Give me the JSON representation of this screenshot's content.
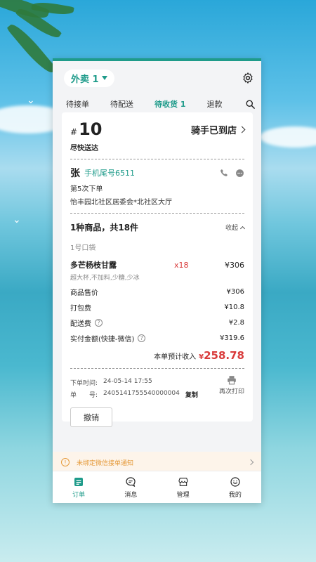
{
  "header": {
    "mode_label": "外卖 1"
  },
  "tabs": [
    {
      "label": "待接单"
    },
    {
      "label": "待配送"
    },
    {
      "label": "待收货 1"
    },
    {
      "label": "退款"
    }
  ],
  "order": {
    "hash": "#",
    "number": "10",
    "rider_status": "骑手已到店",
    "delivery_type": "尽快送达",
    "customer_name": "张",
    "customer_phone": "手机尾号6511",
    "order_count": "第5次下单",
    "address": "怡丰园北社区居委会*北社区大厅",
    "goods_summary": "1种商品，共18件",
    "collapse_label": "收起",
    "bag_label": "1号口袋",
    "item": {
      "name": "多芒杨枝甘露",
      "qty": "x18",
      "price": "¥306",
      "spec": "超大杯,不加料,少糖,少冰"
    },
    "fees": [
      {
        "label": "商品售价",
        "value": "¥306",
        "help": false
      },
      {
        "label": "打包费",
        "value": "¥10.8",
        "help": false
      },
      {
        "label": "配送费",
        "value": "¥2.8",
        "help": true
      },
      {
        "label": "实付金额(快捷-微信)",
        "value": "¥319.6",
        "help": true
      }
    ],
    "income_label": "本单预计收入",
    "income_yen": "¥",
    "income_value": "258.78",
    "order_time_label": "下单时间:",
    "order_time": "24-05-14 17:55",
    "order_id_label": "单　　号:",
    "order_id": "2405141755540000004",
    "copy_label": "复制",
    "reprint_label": "再次打印",
    "cancel_label": "撤销"
  },
  "notice": {
    "text": "未绑定微信接单通知"
  },
  "bottom_nav": [
    {
      "label": "订单",
      "icon": "order-icon"
    },
    {
      "label": "消息",
      "icon": "message-icon"
    },
    {
      "label": "管理",
      "icon": "store-icon"
    },
    {
      "label": "我的",
      "icon": "profile-icon"
    }
  ],
  "colors": {
    "accent": "#1e9b8a",
    "price_red": "#d93b3b",
    "notice": "#e59a3a"
  }
}
